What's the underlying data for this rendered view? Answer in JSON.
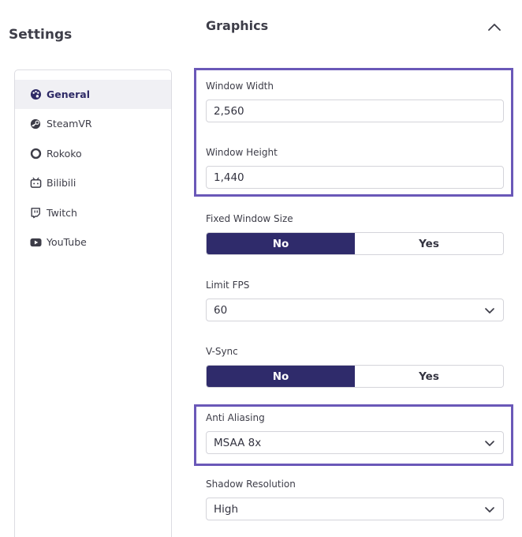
{
  "sidebar": {
    "title": "Settings",
    "items": [
      {
        "label": "General",
        "icon": "palette-icon",
        "active": true
      },
      {
        "label": "SteamVR",
        "icon": "steam-icon",
        "active": false
      },
      {
        "label": "Rokoko",
        "icon": "ring-icon",
        "active": false
      },
      {
        "label": "Bilibili",
        "icon": "bilibili-tv-icon",
        "active": false
      },
      {
        "label": "Twitch",
        "icon": "twitch-icon",
        "active": false
      },
      {
        "label": "YouTube",
        "icon": "youtube-icon",
        "active": false
      }
    ]
  },
  "section": {
    "title": "Graphics",
    "collapse_icon": "chevron-up-icon"
  },
  "fields": {
    "window_width": {
      "label": "Window Width",
      "value": "2,560"
    },
    "window_height": {
      "label": "Window Height",
      "value": "1,440"
    },
    "fixed_window_size": {
      "label": "Fixed Window Size",
      "options": [
        "No",
        "Yes"
      ],
      "selected": "No"
    },
    "limit_fps": {
      "label": "Limit FPS",
      "value": "60"
    },
    "vsync": {
      "label": "V-Sync",
      "options": [
        "No",
        "Yes"
      ],
      "selected": "No"
    },
    "anti_aliasing": {
      "label": "Anti Aliasing",
      "value": "MSAA 8x"
    },
    "shadow_resolution": {
      "label": "Shadow Resolution",
      "value": "High"
    }
  },
  "colors": {
    "accent": "#2f2b6b",
    "highlight_border": "#6a58b8",
    "active_item_bg": "#f0f0f4"
  }
}
